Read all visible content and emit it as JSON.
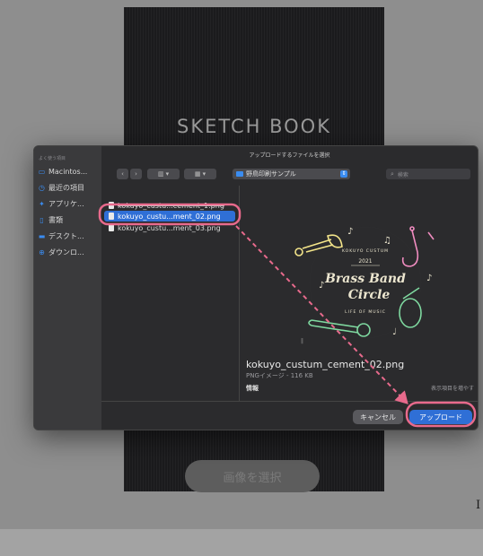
{
  "notebook": {
    "title": "SKETCH BOOK"
  },
  "select_image_button": {
    "label": "画像を選択"
  },
  "side_letter": "I",
  "dialog": {
    "title": "アップロードするファイルを選択",
    "sidebar": {
      "heading": "よく使う項目",
      "items": [
        {
          "label": "Macintos...",
          "icon": "hard-drive-icon"
        },
        {
          "label": "最近の項目",
          "icon": "clock-icon"
        },
        {
          "label": "アプリケ...",
          "icon": "apps-icon"
        },
        {
          "label": "書類",
          "icon": "document-icon"
        },
        {
          "label": "デスクト...",
          "icon": "desktop-icon"
        },
        {
          "label": "ダウンロ...",
          "icon": "download-icon"
        }
      ]
    },
    "toolbar": {
      "view_columns_label": "▥ ▾",
      "view_grid_label": "▦ ▾",
      "location": "野鳥印刷サンプル",
      "search_placeholder": "検索"
    },
    "files": [
      {
        "name": "kokuyo_custu...cement_1.png",
        "selected": false
      },
      {
        "name": "kokuyo_custu...ment_02.png",
        "selected": true
      },
      {
        "name": "kokuyo_custu...ment_03.png",
        "selected": false
      }
    ],
    "preview": {
      "art": {
        "brand": "KOKUYO CUSTUM",
        "year": "2021",
        "line1": "Brass Band",
        "line2": "Circle",
        "tagline": "LIFE OF MUSIC",
        "colors": {
          "pink": "#f08cc0",
          "green": "#7fd9a0",
          "yellow": "#f4e58a",
          "cream": "#ece6cf"
        }
      },
      "filename": "kokuyo_custum_cement_02.png",
      "meta": "PNGイメージ - 116 KB",
      "info_label": "情報",
      "more_label": "表示項目を増やす"
    },
    "buttons": {
      "cancel": "キャンセル",
      "upload": "アップロード"
    }
  },
  "colors": {
    "accent": "#2f6fd6",
    "highlight_ring": "#e86a8c",
    "arrow": "#e86a8c"
  }
}
